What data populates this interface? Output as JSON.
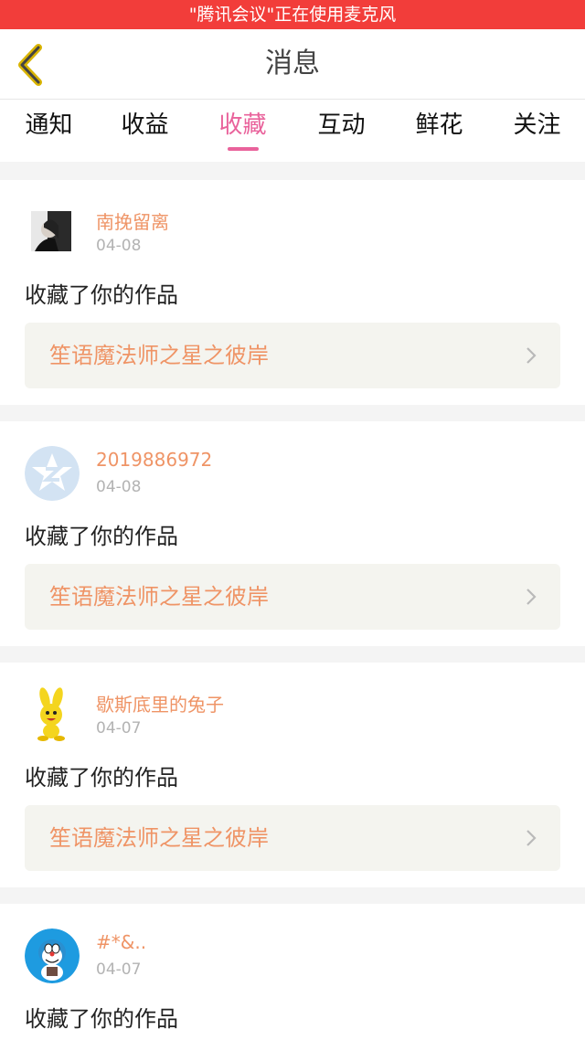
{
  "status_bar": {
    "text": "\"腾讯会议\"正在使用麦克风"
  },
  "header": {
    "title": "消息"
  },
  "tabs": [
    {
      "label": "通知"
    },
    {
      "label": "收益"
    },
    {
      "label": "收藏"
    },
    {
      "label": "互动"
    },
    {
      "label": "鲜花"
    },
    {
      "label": "关注"
    }
  ],
  "active_tab": "收藏",
  "colors": {
    "accent_pink": "#e9629b",
    "username_orange": "#ef9466",
    "status_red": "#f23d3a"
  },
  "messages": [
    {
      "username": "南挽留离",
      "date": "04-08",
      "action": "收藏了你的作品",
      "work_title": "笙语魔法师之星之彼岸",
      "avatar": "photo-portrait"
    },
    {
      "username": "2019886972",
      "date": "04-08",
      "action": "收藏了你的作品",
      "work_title": "笙语魔法师之星之彼岸",
      "avatar": "qq-default-avatar"
    },
    {
      "username": "歇斯底里的兔子",
      "date": "04-07",
      "action": "收藏了你的作品",
      "work_title": "笙语魔法师之星之彼岸",
      "avatar": "yellow-rabbit"
    },
    {
      "username": "#*&..",
      "date": "04-07",
      "action": "收藏了你的作品",
      "work_title": "",
      "avatar": "doraemon"
    }
  ]
}
